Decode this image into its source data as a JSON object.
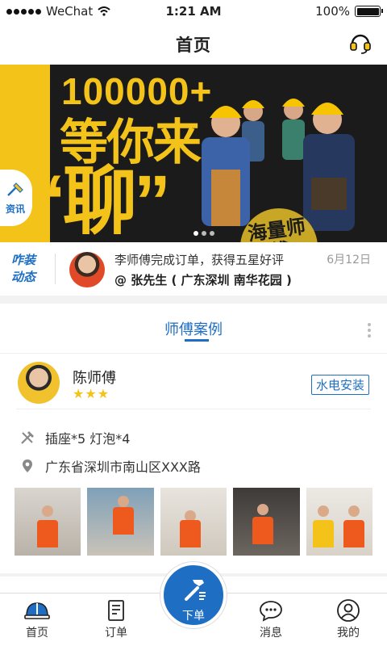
{
  "status_bar": {
    "carrier": "WeChat",
    "time": "1:21 AM",
    "battery": "100%"
  },
  "header": {
    "title": "首页",
    "support_icon": "headset-icon"
  },
  "banner": {
    "headline_number": "100000+",
    "headline_text": "等你来",
    "quote_text": "“聊”",
    "badge_text": "海量师傅",
    "side_tag_label": "资讯",
    "colors": {
      "yellow": "#f3c31a",
      "dark": "#1b1b1b"
    }
  },
  "news": {
    "tag": "咋装动态",
    "line1": "李师傅完成订单，获得五星好评",
    "line2": "@ 张先生 ( 广东深圳 南华花园 )",
    "date": "6月12日"
  },
  "cases": {
    "title": "师傅案例",
    "card": {
      "worker_name": "陈师傅",
      "stars": "★★★",
      "rating": 3,
      "service_tag": "水电安装",
      "items": "插座*5  灯泡*4",
      "address": "广东省深圳市南山区XXX路",
      "photos": [
        "photo-1",
        "photo-2",
        "photo-3",
        "photo-4",
        "photo-5"
      ]
    }
  },
  "tabbar": {
    "home": "首页",
    "orders": "订单",
    "order_now": "下单",
    "messages": "消息",
    "me": "我的"
  },
  "accent_color": "#1e6fc3"
}
